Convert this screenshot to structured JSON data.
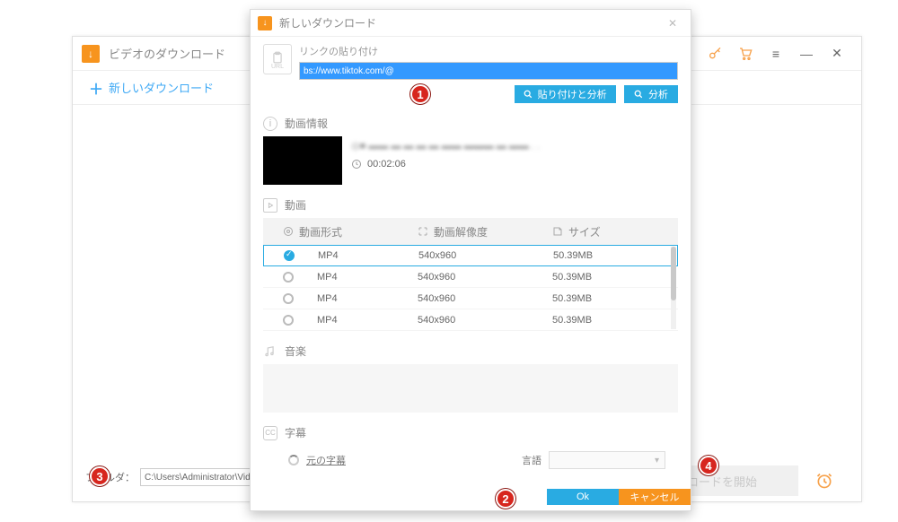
{
  "main": {
    "title": "ビデオのダウンロード",
    "new_download": "新しいダウンロード",
    "folder_label": "フォルダ：",
    "folder_path": "C:\\Users\\Administrator\\Vide",
    "start_btn": "ロードを開始"
  },
  "dialog": {
    "title": "新しいダウンロード",
    "link_label": "リンクの貼り付け",
    "url_value": "bs://www.tiktok.com/@",
    "paste_analyze": "貼り付けと分析",
    "analyze": "分析",
    "videoinfo_label": "動画情報",
    "duration": "00:02:06",
    "video_section": "動画",
    "th_format": "動画形式",
    "th_res": "動画解像度",
    "th_size": "サイズ",
    "rows": [
      {
        "fmt": "MP4",
        "res": "540x960",
        "size": "50.39MB"
      },
      {
        "fmt": "MP4",
        "res": "540x960",
        "size": "50.39MB"
      },
      {
        "fmt": "MP4",
        "res": "540x960",
        "size": "50.39MB"
      },
      {
        "fmt": "MP4",
        "res": "540x960",
        "size": "50.39MB"
      }
    ],
    "music_section": "音楽",
    "subtitle_section": "字幕",
    "orig_sub": "元の字幕",
    "language_label": "言語",
    "ok": "Ok",
    "cancel": "キャンセル"
  },
  "badges": {
    "b1": "1",
    "b2": "2",
    "b3": "3",
    "b4": "4"
  }
}
